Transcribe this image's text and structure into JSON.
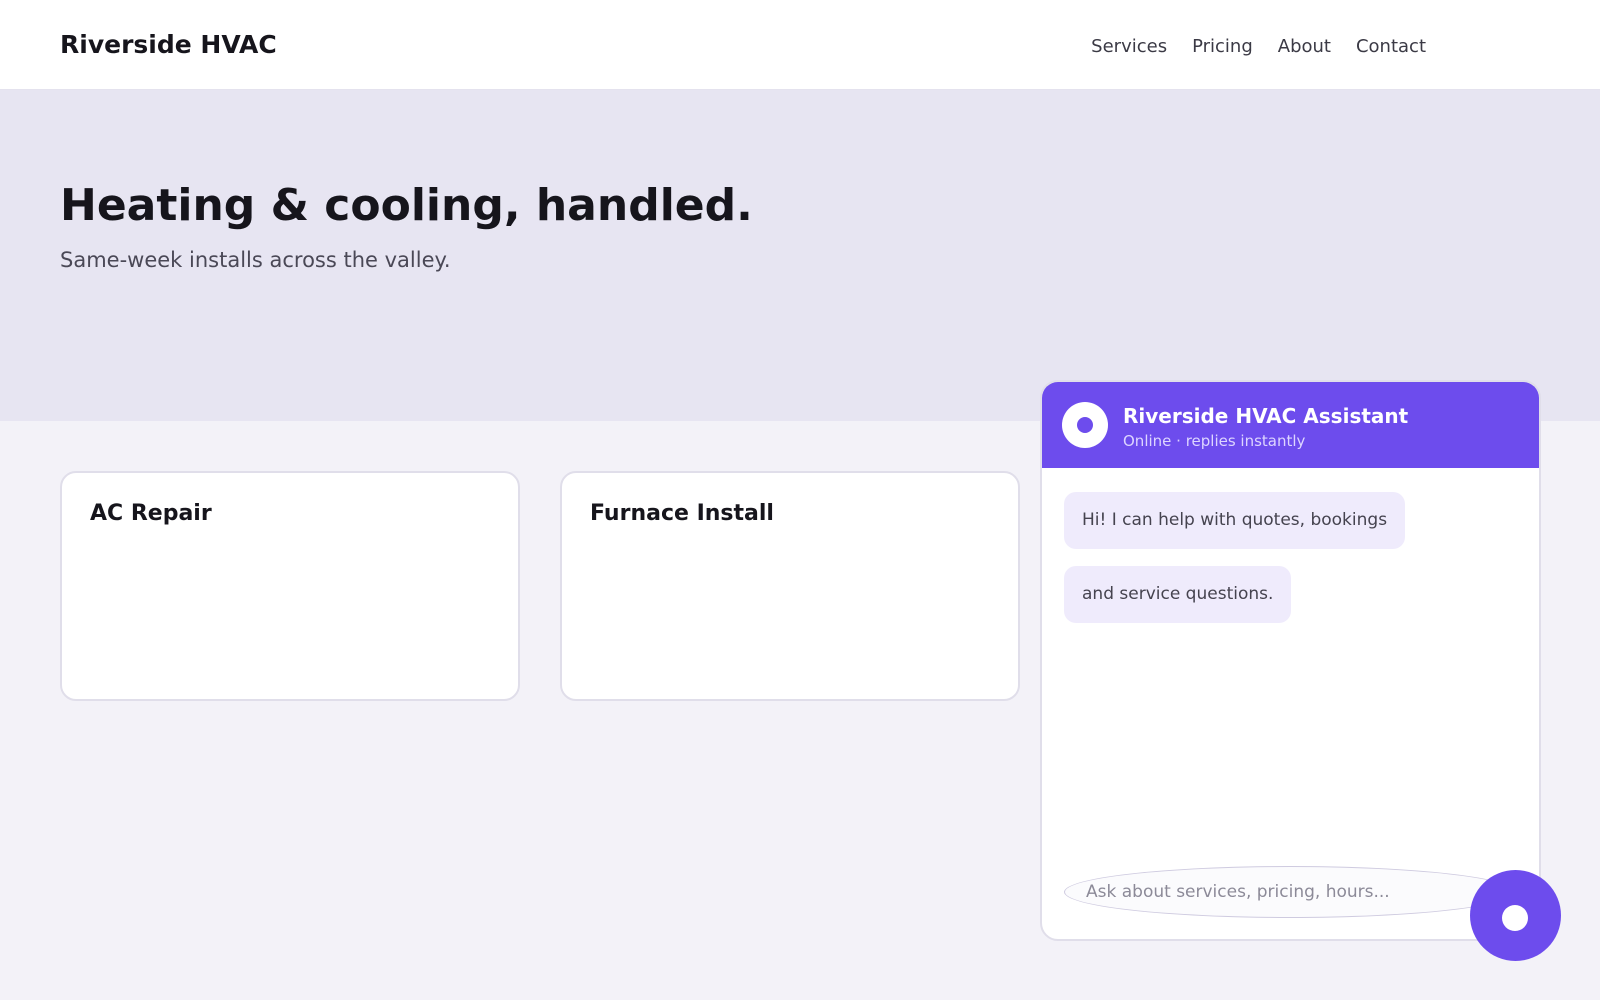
{
  "header": {
    "brand": "Riverside HVAC",
    "nav": [
      "Services",
      "Pricing",
      "About",
      "Contact"
    ]
  },
  "hero": {
    "title": "Heating & cooling, handled.",
    "subtitle": "Same-week installs across the valley."
  },
  "services": [
    {
      "title": "AC Repair"
    },
    {
      "title": "Furnace Install"
    }
  ],
  "chat": {
    "name": "Riverside HVAC Assistant",
    "status": "Online · replies instantly",
    "messages": [
      "Hi! I can help with quotes, bookings",
      "and service questions."
    ],
    "input_placeholder": "Ask about services, pricing, hours..."
  },
  "colors": {
    "accent": "#6d4ced",
    "hero_bg": "#e7e5f2",
    "page_bg": "#f3f2f8",
    "bubble_bg": "#efebfc"
  },
  "icons": {
    "chat_avatar": "chat-avatar-icon",
    "launcher": "chat-launcher-icon"
  }
}
